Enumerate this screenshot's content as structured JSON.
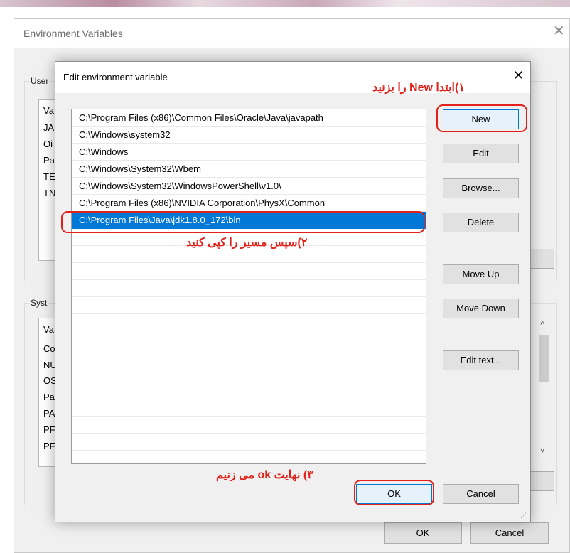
{
  "env_dialog": {
    "title": "Environment Variables",
    "close_icon": "close-icon",
    "user_group_label": "User",
    "user_list_fragments": [
      "Va",
      "JA",
      "Oi",
      "Pa",
      "TE",
      "TN"
    ],
    "system_group_label": "Syst",
    "system_list_fragments": [
      "Va",
      "Co",
      "NU",
      "OS",
      "Pa",
      "PA",
      "PF",
      "PF"
    ],
    "ok_label": "OK",
    "cancel_label": "Cancel"
  },
  "edit_dialog": {
    "title": "Edit environment variable",
    "close_glyph": "✕",
    "paths": [
      "C:\\Program Files (x86)\\Common Files\\Oracle\\Java\\javapath",
      "C:\\Windows\\system32",
      "C:\\Windows",
      "C:\\Windows\\System32\\Wbem",
      "C:\\Windows\\System32\\WindowsPowerShell\\v1.0\\",
      "C:\\Program Files (x86)\\NVIDIA Corporation\\PhysX\\Common",
      "C:\\Program Files\\Java\\jdk1.8.0_172\\bin"
    ],
    "selected_index": 6,
    "buttons": {
      "new": "New",
      "edit": "Edit",
      "browse": "Browse...",
      "delete": "Delete",
      "move_up": "Move Up",
      "move_down": "Move Down",
      "edit_text": "Edit text...",
      "ok": "OK",
      "cancel": "Cancel"
    }
  },
  "annotations": {
    "step1": "۱)ابتدا New را بزنید",
    "step2": "۲)سپس مسیر را کپی کنید",
    "step3": "۳) نهایت ok می زنیم",
    "color": "#e2221a"
  },
  "colors": {
    "selection": "#0078d7",
    "dialog_bg": "#f0f0f0"
  }
}
